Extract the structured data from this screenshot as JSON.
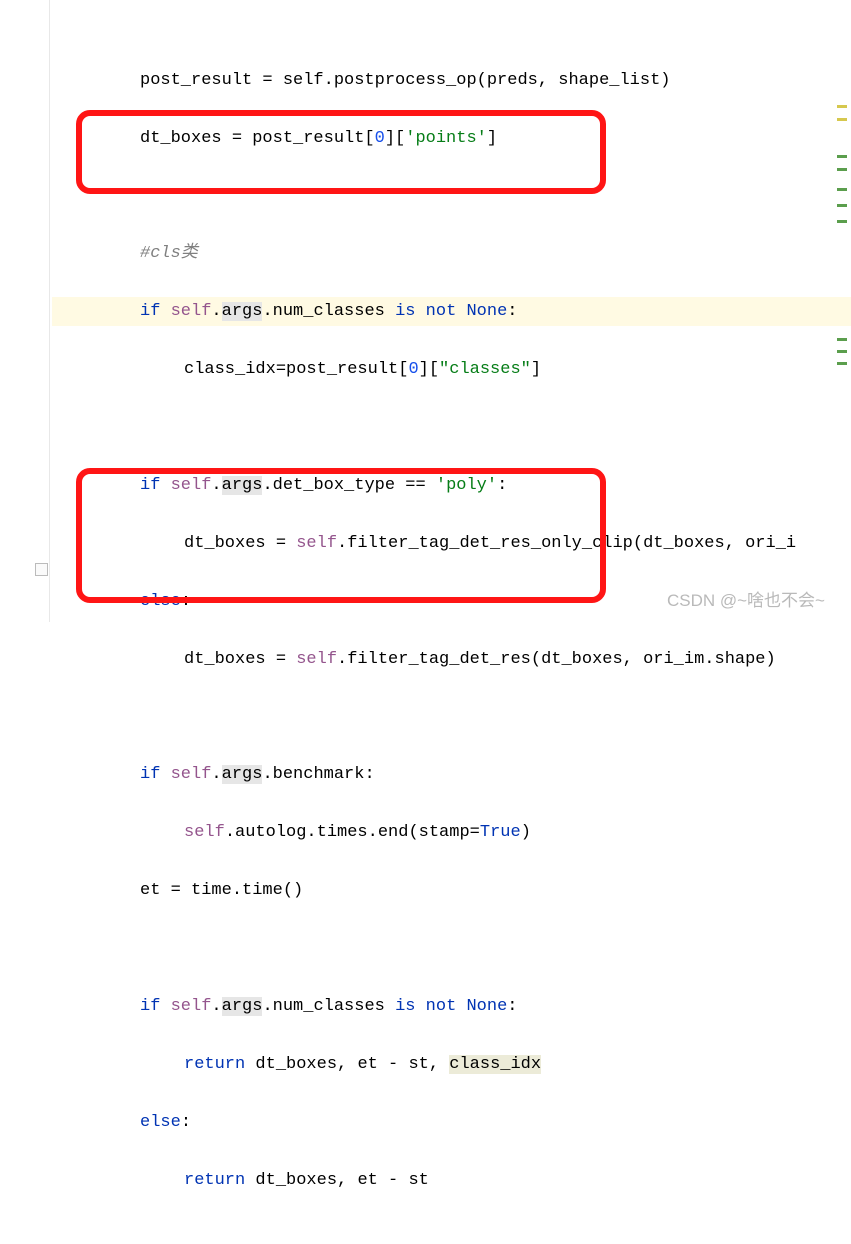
{
  "code": {
    "l1": "post_result = self.postprocess_op(preds, shape_list)",
    "l2_a": "dt_boxes = post_result[",
    "l2_b": "0",
    "l2_c": "][",
    "l2_d": "'points'",
    "l2_e": "]",
    "l4_comment": "#cls类",
    "l5_a": "if ",
    "l5_b": "self",
    "l5_c": ".",
    "l5_d": "args",
    "l5_e": ".num_classes ",
    "l5_f": "is not None",
    "l5_g": ":",
    "l6_a": "class_idx=post_result[",
    "l6_b": "0",
    "l6_c": "][",
    "l6_d": "\"classes\"",
    "l6_e": "]",
    "l8_a": "if ",
    "l8_b": "self",
    "l8_c": ".",
    "l8_d": "args",
    "l8_e": ".det_box_type == ",
    "l8_f": "'poly'",
    "l8_g": ":",
    "l9_a": "dt_boxes = ",
    "l9_b": "self",
    "l9_c": ".filter_tag_det_res_only_clip(dt_boxes, ori_i",
    "l10_a": "else",
    "l10_b": ":",
    "l11_a": "dt_boxes = ",
    "l11_b": "self",
    "l11_c": ".filter_tag_det_res(dt_boxes, ori_im.shape)",
    "l13_a": "if ",
    "l13_b": "self",
    "l13_c": ".",
    "l13_d": "args",
    "l13_e": ".benchmark:",
    "l14_a": "self",
    "l14_b": ".autolog.times.end(",
    "l14_c": "stamp",
    "l14_d": "=",
    "l14_e": "True",
    "l14_f": ")",
    "l15": "et = time.time()",
    "l17_a": "if ",
    "l17_b": "self",
    "l17_c": ".",
    "l17_d": "args",
    "l17_e": ".num_classes ",
    "l17_f": "is not None",
    "l17_g": ":",
    "l18_a": "return ",
    "l18_b": "dt_boxes, et - st, ",
    "l18_c": "class_idx",
    "l19_a": "else",
    "l19_b": ":",
    "l20_a": "return ",
    "l20_b": "dt_boxes, et - st"
  },
  "watermark": "CSDN @~啥也不会~"
}
